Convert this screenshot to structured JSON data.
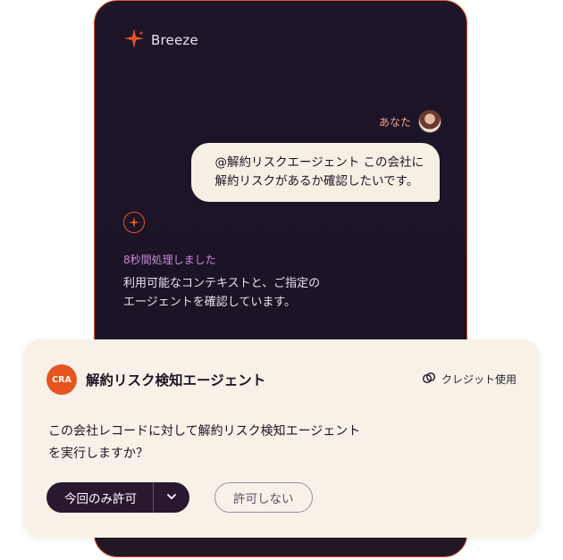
{
  "app": {
    "brand_name": "Breeze",
    "brand_icon": "sparkle-icon",
    "accent_color": "#E2552B",
    "background_color": "#1E1529"
  },
  "chat": {
    "user_label": "あなた",
    "user_avatar": "avatar",
    "user_message_lines": [
      "@解約リスクエージェント この会社に",
      "解約リスクがあるか確認したいです。"
    ],
    "agent_icon": "sparkle-icon",
    "processing_status": "8秒間処理しました",
    "agent_reply_lines": [
      "利用可能なコンテキストと、ご指定の",
      "エージェントを確認しています。"
    ]
  },
  "approval_card": {
    "badge": "CRA",
    "title": "解約リスク検知エージェント",
    "credit_label": "クレジット使用",
    "credit_icon": "credits-icon",
    "question_lines": [
      "この会社レコードに対して解約リスク検知エージェント",
      "を実行しますか？"
    ],
    "allow_once_label": "今回のみ許可",
    "dropdown_icon": "chevron-down-icon",
    "deny_label": "許可しない"
  }
}
